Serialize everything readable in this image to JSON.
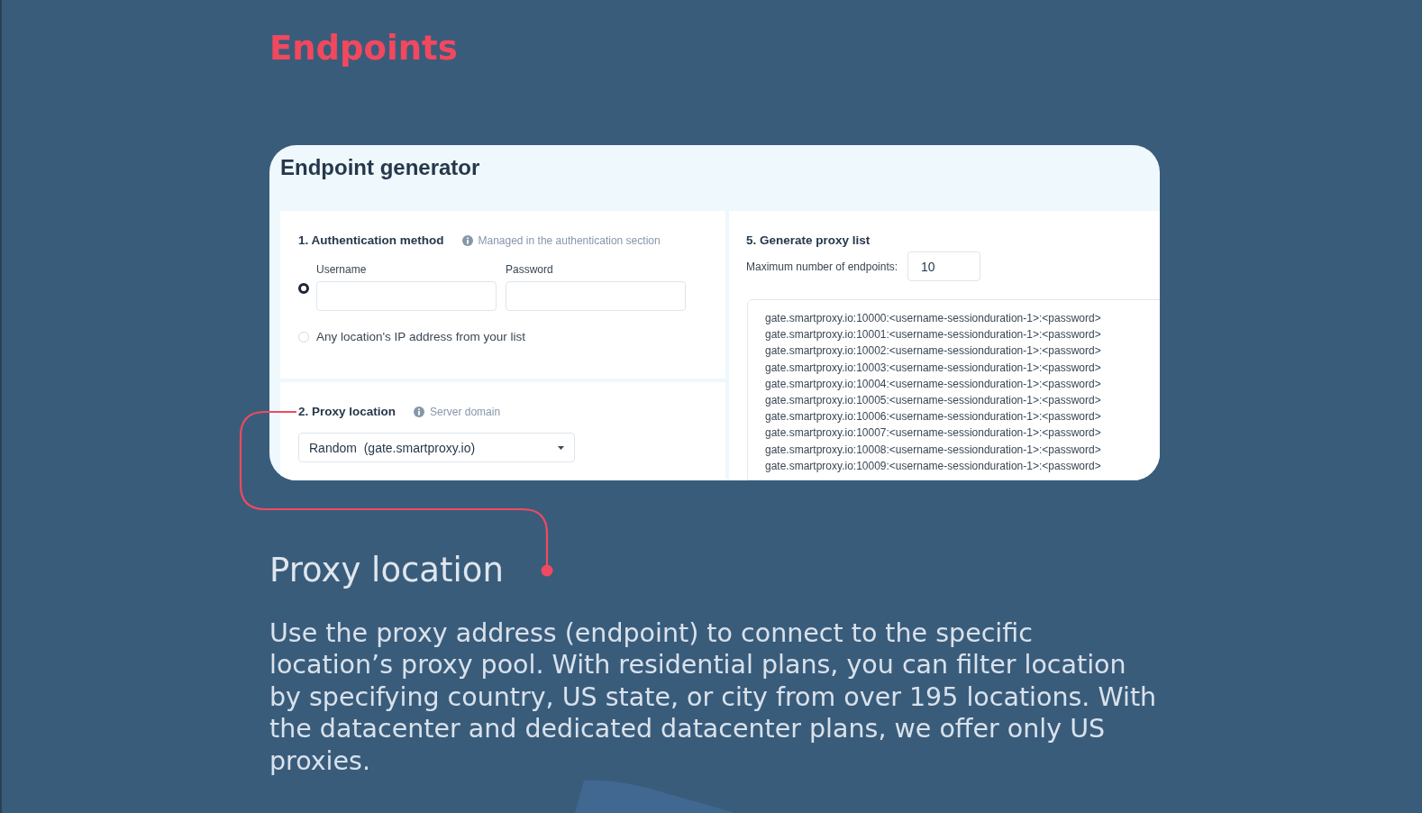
{
  "page_title": "Endpoints",
  "generator": {
    "title": "Endpoint generator",
    "auth": {
      "heading": "1. Authentication method",
      "hint": "Managed in the authentication section",
      "options": [
        {
          "kind": "credentials",
          "selected": true,
          "fields": [
            {
              "label": "Username"
            },
            {
              "label": "Password"
            }
          ]
        },
        {
          "kind": "whitelist",
          "selected": false,
          "label": "Any location's IP address from your list"
        }
      ]
    },
    "location": {
      "heading": "2. Proxy location",
      "hint": "Server domain",
      "dropdown": {
        "value": "Random  (gate.smartproxy.io)"
      }
    },
    "proxy_list": {
      "heading": "5. Generate proxy list",
      "max_label": "Maximum number of endpoints:",
      "max_value": "10",
      "endpoints": [
        "gate.smartproxy.io:10000:<username-sessionduration-1>:<password>",
        "gate.smartproxy.io:10001:<username-sessionduration-1>:<password>",
        "gate.smartproxy.io:10002:<username-sessionduration-1>:<password>",
        "gate.smartproxy.io:10003:<username-sessionduration-1>:<password>",
        "gate.smartproxy.io:10004:<username-sessionduration-1>:<password>",
        "gate.smartproxy.io:10005:<username-sessionduration-1>:<password>",
        "gate.smartproxy.io:10006:<username-sessionduration-1>:<password>",
        "gate.smartproxy.io:10007:<username-sessionduration-1>:<password>",
        "gate.smartproxy.io:10008:<username-sessionduration-1>:<password>",
        "gate.smartproxy.io:10009:<username-sessionduration-1>:<password>"
      ]
    }
  },
  "section": {
    "heading": "Proxy location",
    "body": "Use the proxy address (endpoint) to connect to the specific location’s proxy pool. With residential plans, you can filter location by specifying country, US state, or city from over 195 locations. With the datacenter and dedicated datacenter plans, we offer only US proxies."
  }
}
